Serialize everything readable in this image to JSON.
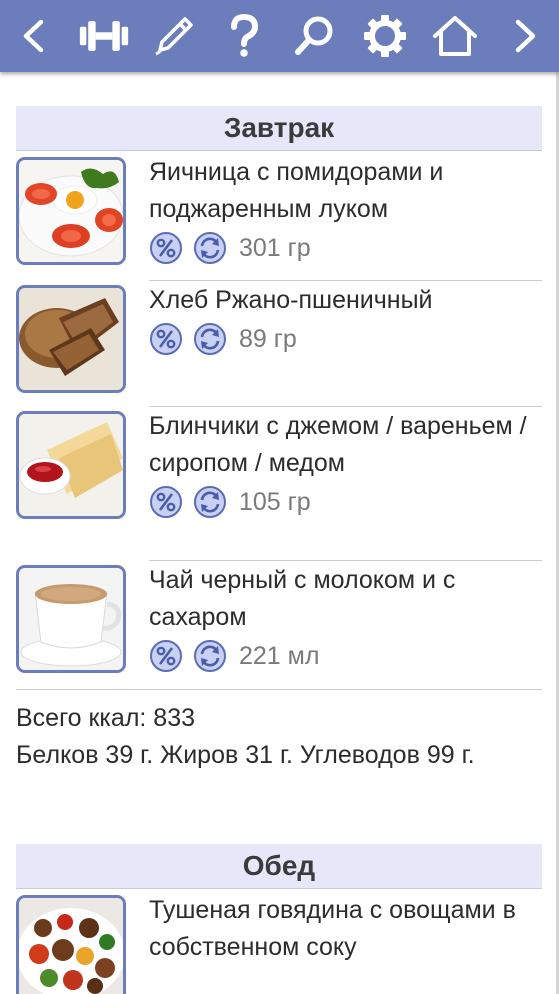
{
  "toolbar": {
    "buttons": [
      {
        "icon": "chevron-left-icon"
      },
      {
        "icon": "dumbbell-icon"
      },
      {
        "icon": "pen-icon"
      },
      {
        "icon": "help-icon"
      },
      {
        "icon": "search-icon"
      },
      {
        "icon": "gear-icon"
      },
      {
        "icon": "home-icon"
      },
      {
        "icon": "chevron-right-icon"
      }
    ],
    "color": "#6b7dbb"
  },
  "meals": [
    {
      "title": "Завтрак",
      "items": [
        {
          "name": "Яичница с помидорами и поджаренным луком",
          "weight": "301 гр",
          "image": "fried-eggs-tomatoes"
        },
        {
          "name": "Хлеб Ржано-пшеничный",
          "weight": "89 гр",
          "image": "rye-bread"
        },
        {
          "name": "Блинчики с джемом / вареньем / сиропом / медом",
          "weight": "105 гр",
          "image": "crepes-with-jam"
        },
        {
          "name": "Чай черный с молоком и с сахаром",
          "weight": "221 мл",
          "image": "tea-with-milk"
        }
      ],
      "totals": {
        "kcal": "Всего ккал: 833",
        "macros": "Белков 39 г. Жиров 31 г. Углеводов 99 г."
      }
    },
    {
      "title": "Обед",
      "items": [
        {
          "name": "Тушеная говядина с овощами в собственном соку",
          "image": "stewed-beef-vegetables"
        }
      ]
    }
  ]
}
